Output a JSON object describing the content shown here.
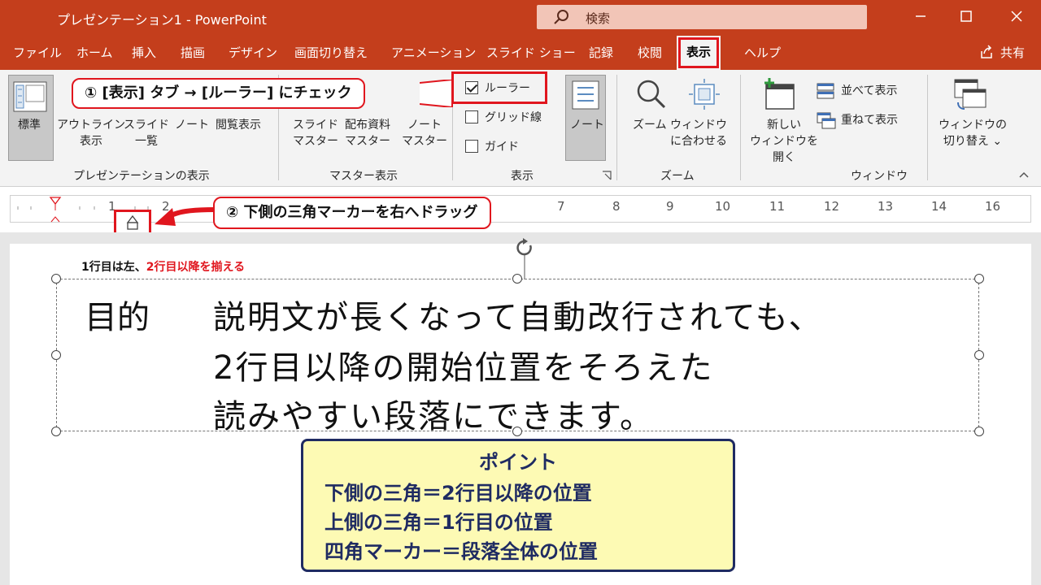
{
  "titlebar": {
    "title": "プレゼンテーション1 - PowerPoint",
    "search_placeholder": "検索"
  },
  "tabs": [
    "ファイル",
    "ホーム",
    "挿入",
    "描画",
    "デザイン",
    "画面切り替え",
    "アニメーション",
    "スライド ショー",
    "記録",
    "校閲",
    "表示",
    "ヘルプ"
  ],
  "active_tab": "表示",
  "share_label": "共有",
  "ribbon": {
    "presentation_views": {
      "title": "プレゼンテーションの表示",
      "normal": "標準",
      "outline": [
        "アウトライン",
        "表示"
      ],
      "slide_sorter": [
        "スライド",
        "一覧"
      ],
      "notes_page": "ノート",
      "reading_view": "閲覧表示"
    },
    "master_views": {
      "title": "マスター表示",
      "slide_master": [
        "スライド",
        "マスター"
      ],
      "handout_master": [
        "配布資料",
        "マスター"
      ],
      "notes_master": [
        "ノート",
        "マスター"
      ]
    },
    "show": {
      "title": "表示",
      "ruler": "ルーラー",
      "gridlines": "グリッド線",
      "guides": "ガイド",
      "ruler_checked": true,
      "notes": "ノート"
    },
    "zoom": {
      "title": "ズーム",
      "zoom": "ズーム",
      "fit": [
        "ウィンドウ",
        "に合わせる"
      ]
    },
    "window": {
      "title": "ウィンドウ",
      "new_window": [
        "新しい",
        "ウィンドウを",
        "開く"
      ],
      "arrange": "並べて表示",
      "cascade": "重ねて表示",
      "switch": [
        "ウィンドウの",
        "切り替え ⌄"
      ]
    }
  },
  "callouts": {
    "step1": "① [表示] タブ → [ルーラー] にチェック",
    "step2": "② 下側の三角マーカーを右へドラッグ"
  },
  "ruler_numbers": [
    "1",
    "2",
    "7",
    "8",
    "9",
    "10",
    "11",
    "12",
    "13",
    "14",
    "16"
  ],
  "slide": {
    "note_black": "1行目は左、",
    "note_red": "2行目以降を揃える",
    "label": "目的",
    "lines": [
      "説明文が長くなって自動改行されても、",
      "2行目以降の開始位置をそろえた",
      "読みやすい段落にできます。"
    ],
    "point": {
      "title": "ポイント",
      "lines": [
        "下側の三角＝2行目以降の位置",
        "上側の三角＝1行目の位置",
        "四角マーカー＝段落全体の位置"
      ]
    }
  },
  "colors": {
    "accent": "#c43e1c",
    "highlight": "#e0161e",
    "point_bg": "#fdfab4",
    "point_text": "#1f2b62"
  }
}
